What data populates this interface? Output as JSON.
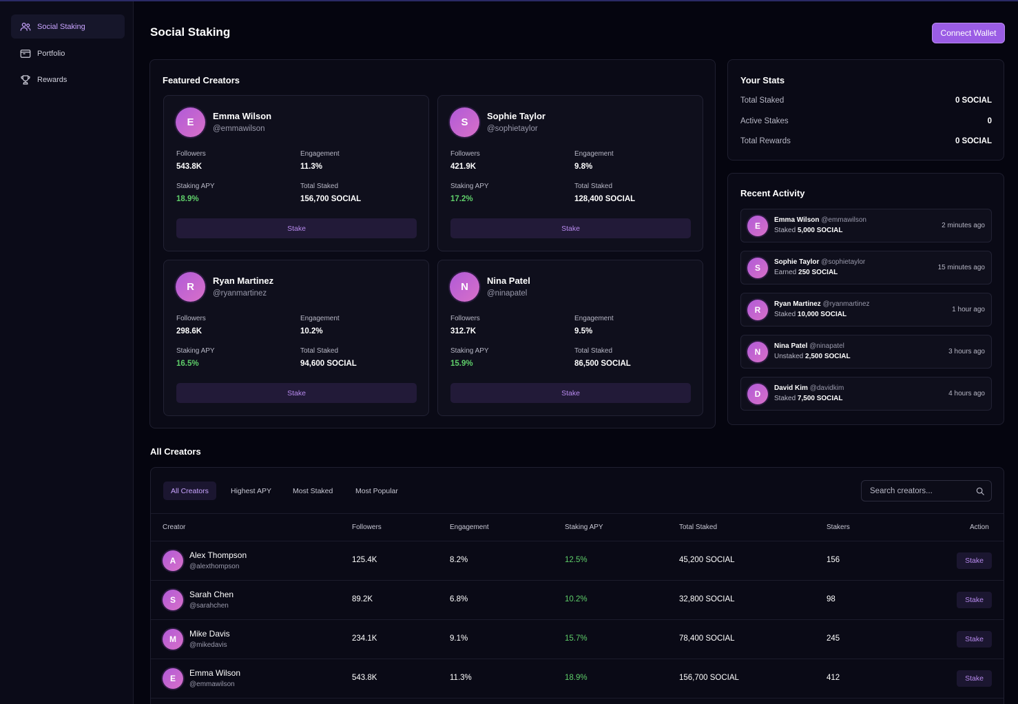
{
  "sidebar": {
    "items": [
      {
        "label": "Social Staking",
        "icon": "users-icon",
        "active": true
      },
      {
        "label": "Portfolio",
        "icon": "wallet-icon",
        "active": false
      },
      {
        "label": "Rewards",
        "icon": "trophy-icon",
        "active": false
      }
    ]
  },
  "header": {
    "title": "Social Staking",
    "connect_label": "Connect Wallet"
  },
  "featured": {
    "title": "Featured Creators",
    "labels": {
      "followers": "Followers",
      "engagement": "Engagement",
      "apy": "Staking APY",
      "staked": "Total Staked",
      "stake": "Stake"
    },
    "creators": [
      {
        "initial": "E",
        "name": "Emma Wilson",
        "handle": "@emmawilson",
        "followers": "543.8K",
        "engagement": "11.3%",
        "apy": "18.9%",
        "staked": "156,700 SOCIAL"
      },
      {
        "initial": "S",
        "name": "Sophie Taylor",
        "handle": "@sophietaylor",
        "followers": "421.9K",
        "engagement": "9.8%",
        "apy": "17.2%",
        "staked": "128,400 SOCIAL"
      },
      {
        "initial": "R",
        "name": "Ryan Martinez",
        "handle": "@ryanmartinez",
        "followers": "298.6K",
        "engagement": "10.2%",
        "apy": "16.5%",
        "staked": "94,600 SOCIAL"
      },
      {
        "initial": "N",
        "name": "Nina Patel",
        "handle": "@ninapatel",
        "followers": "312.7K",
        "engagement": "9.5%",
        "apy": "15.9%",
        "staked": "86,500 SOCIAL"
      }
    ]
  },
  "your_stats": {
    "title": "Your Stats",
    "rows": [
      {
        "label": "Total Staked",
        "value": "0 SOCIAL"
      },
      {
        "label": "Active Stakes",
        "value": "0"
      },
      {
        "label": "Total Rewards",
        "value": "0 SOCIAL"
      }
    ]
  },
  "activity": {
    "title": "Recent Activity",
    "items": [
      {
        "initial": "E",
        "name": "Emma Wilson",
        "handle": "@emmawilson",
        "action": "Staked",
        "amount": "5,000 SOCIAL",
        "time": "2 minutes ago"
      },
      {
        "initial": "S",
        "name": "Sophie Taylor",
        "handle": "@sophietaylor",
        "action": "Earned",
        "amount": "250 SOCIAL",
        "time": "15 minutes ago"
      },
      {
        "initial": "R",
        "name": "Ryan Martinez",
        "handle": "@ryanmartinez",
        "action": "Staked",
        "amount": "10,000 SOCIAL",
        "time": "1 hour ago"
      },
      {
        "initial": "N",
        "name": "Nina Patel",
        "handle": "@ninapatel",
        "action": "Unstaked",
        "amount": "2,500 SOCIAL",
        "time": "3 hours ago"
      },
      {
        "initial": "D",
        "name": "David Kim",
        "handle": "@davidkim",
        "action": "Staked",
        "amount": "7,500 SOCIAL",
        "time": "4 hours ago"
      }
    ]
  },
  "all_creators": {
    "title": "All Creators",
    "tabs": [
      "All Creators",
      "Highest APY",
      "Most Staked",
      "Most Popular"
    ],
    "active_tab": "All Creators",
    "search_placeholder": "Search creators...",
    "columns": [
      "Creator",
      "Followers",
      "Engagement",
      "Staking APY",
      "Total Staked",
      "Stakers",
      "Action"
    ],
    "stake_label": "Stake",
    "rows": [
      {
        "initial": "A",
        "name": "Alex Thompson",
        "handle": "@alexthompson",
        "followers": "125.4K",
        "engagement": "8.2%",
        "apy": "12.5%",
        "staked": "45,200 SOCIAL",
        "stakers": "156"
      },
      {
        "initial": "S",
        "name": "Sarah Chen",
        "handle": "@sarahchen",
        "followers": "89.2K",
        "engagement": "6.8%",
        "apy": "10.2%",
        "staked": "32,800 SOCIAL",
        "stakers": "98"
      },
      {
        "initial": "M",
        "name": "Mike Davis",
        "handle": "@mikedavis",
        "followers": "234.1K",
        "engagement": "9.1%",
        "apy": "15.7%",
        "staked": "78,400 SOCIAL",
        "stakers": "245"
      },
      {
        "initial": "E",
        "name": "Emma Wilson",
        "handle": "@emmawilson",
        "followers": "543.8K",
        "engagement": "11.3%",
        "apy": "18.9%",
        "staked": "156,700 SOCIAL",
        "stakers": "412"
      }
    ]
  },
  "colors": {
    "accent": "#9b5de5",
    "positive": "#5fcf6a",
    "background": "#05050f"
  }
}
